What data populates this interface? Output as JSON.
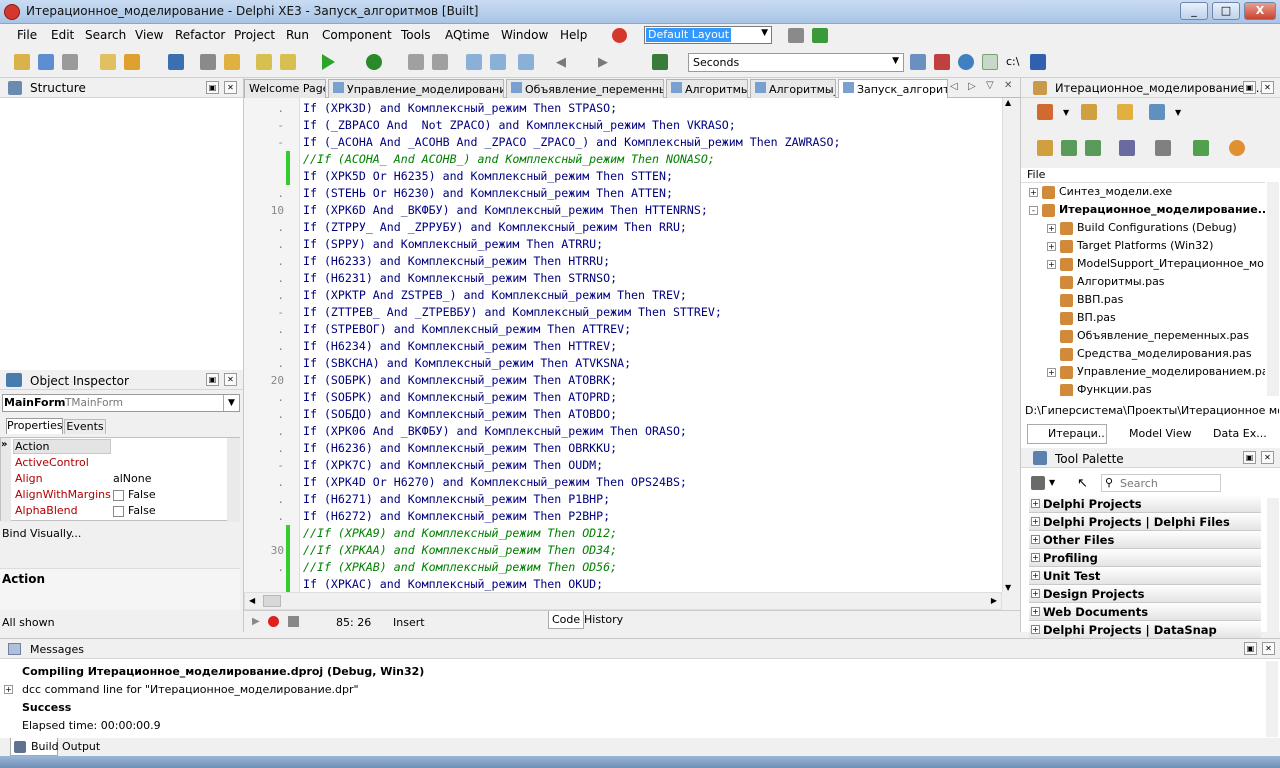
{
  "window": {
    "title": "Итерационное_моделирование - Delphi XE3 - Запуск_алгоритмов [Built]",
    "btn_minimize": "_",
    "btn_maximize": "□",
    "btn_close": "X"
  },
  "menu": [
    "File",
    "Edit",
    "Search",
    "View",
    "Refactor",
    "Project",
    "Run",
    "Component",
    "Tools",
    "AQtime",
    "Window",
    "Help"
  ],
  "layout_select": "Default Layout",
  "toolbar": {
    "seconds": "Seconds",
    "path_icon_label": "c:\\"
  },
  "structure": {
    "title": "Structure"
  },
  "object_inspector": {
    "title": "Object Inspector",
    "selected_name": "MainForm",
    "selected_type": "TMainForm",
    "tab_properties": "Properties",
    "tab_events": "Events",
    "props": [
      {
        "name": "Action",
        "value": ""
      },
      {
        "name": "ActiveControl",
        "value": ""
      },
      {
        "name": "Align",
        "value": "alNone"
      },
      {
        "name": "AlignWithMargins",
        "value": "False"
      },
      {
        "name": "AlphaBlend",
        "value": "False"
      }
    ],
    "bind_visually": "Bind Visually...",
    "desc_title": "Action",
    "footer": "All shown"
  },
  "editor": {
    "tabs": [
      "Welcome Page",
      "Управление_моделированием",
      "Объявление_переменных",
      "Алгоритмы",
      "Алгоритмы_",
      "Запуск_алгоритм"
    ],
    "line_numbers": [
      {
        "row": 6,
        "num": "10"
      },
      {
        "row": 16,
        "num": "20"
      },
      {
        "row": 26,
        "num": "30"
      }
    ],
    "lines": [
      {
        "text": "If (XPK3D) and Комплексный_режим Then STPASO;",
        "cmt": false,
        "mark": false,
        "g": "."
      },
      {
        "text": "If (_ZBPACO And  Not ZPACO) and Комплексный_режим Then VKRASO;",
        "cmt": false,
        "mark": false,
        "g": "-"
      },
      {
        "text": "If (_ACOHA And _ACOHB And _ZPACO _ZPACO_) and Комплексный_режим Then ZAWRASO;",
        "cmt": false,
        "mark": false,
        "g": "-"
      },
      {
        "text": "//If (ACOHA_ And ACOHB_) and Комплексный_режим Then NONASO;",
        "cmt": true,
        "mark": true,
        "g": ""
      },
      {
        "text": "If (XPK5D Or H6235) and Комплексный_режим Then STTEN;",
        "cmt": false,
        "mark": true,
        "g": ""
      },
      {
        "text": "If (STEHЬ Or H6230) and Комплексный_режим Then ATTEN;",
        "cmt": false,
        "mark": false,
        "g": "."
      },
      {
        "text": "If (XPK6D And _BKФБУ) and Комплексный_режим Then HTTENRNS;",
        "cmt": false,
        "mark": false,
        "g": ""
      },
      {
        "text": "If (ZTPPУ_ And _ZPPУБУ) and Комплексный_режим Then RRU;",
        "cmt": false,
        "mark": false,
        "g": "."
      },
      {
        "text": "If (SPPУ) and Комплексный_режим Then ATRRU;",
        "cmt": false,
        "mark": false,
        "g": "."
      },
      {
        "text": "If (H6233) and Комплексный_режим Then HTRRU;",
        "cmt": false,
        "mark": false,
        "g": "."
      },
      {
        "text": "If (H6231) and Комплексный_режим Then STRNSO;",
        "cmt": false,
        "mark": false,
        "g": "."
      },
      {
        "text": "If (XPKTP And ZSTPEB_) and Комплексный_режим Then TREV;",
        "cmt": false,
        "mark": false,
        "g": "."
      },
      {
        "text": "If (ZTTPEB_ And _ZTPEBБУ) and Комплексный_режим Then STTREV;",
        "cmt": false,
        "mark": false,
        "g": "-"
      },
      {
        "text": "If (STPEBOГ) and Комплексный_режим Then ATTREV;",
        "cmt": false,
        "mark": false,
        "g": "."
      },
      {
        "text": "If (H6234) and Комплексный_режим Then HTTREV;",
        "cmt": false,
        "mark": false,
        "g": "."
      },
      {
        "text": "If (SBKCHA) and Комплексный_режим Then ATVKSNA;",
        "cmt": false,
        "mark": false,
        "g": "."
      },
      {
        "text": "If (SOБPK) and Комплексный_режим Then ATOBRK;",
        "cmt": false,
        "mark": false,
        "g": ""
      },
      {
        "text": "If (SOБPK) and Комплексный_режим Then ATOPRD;",
        "cmt": false,
        "mark": false,
        "g": "."
      },
      {
        "text": "If (SOБДO) and Комплексный_режим Then ATOBDO;",
        "cmt": false,
        "mark": false,
        "g": "."
      },
      {
        "text": "If (XPK06 And _BKФБУ) and Комплексный_режим Then ORASO;",
        "cmt": false,
        "mark": false,
        "g": "."
      },
      {
        "text": "If (H6236) and Комплексный_режим Then OBRKKU;",
        "cmt": false,
        "mark": false,
        "g": "."
      },
      {
        "text": "If (XPK7C) and Комплексный_режим Then OUDM;",
        "cmt": false,
        "mark": false,
        "g": "-"
      },
      {
        "text": "If (XPK4D Or H6270) and Комплексный_режим Then OPS24BS;",
        "cmt": false,
        "mark": false,
        "g": "."
      },
      {
        "text": "If (H6271) and Комплексный_режим Then P1BHP;",
        "cmt": false,
        "mark": false,
        "g": "."
      },
      {
        "text": "If (H6272) and Комплексный_режим Then P2BHP;",
        "cmt": false,
        "mark": false,
        "g": "."
      },
      {
        "text": "//If (XPKA9) and Комплексный_режим Then OD12;",
        "cmt": true,
        "mark": true,
        "g": ""
      },
      {
        "text": "//If (XPKAA) and Комплексный_режим Then OD34;",
        "cmt": true,
        "mark": true,
        "g": ""
      },
      {
        "text": "//If (XPKAB) and Комплексный_режим Then OD56;",
        "cmt": true,
        "mark": true,
        "g": "."
      },
      {
        "text": "If (XPKAC) and Комплексный_режим Then OKUD;",
        "cmt": false,
        "mark": true,
        "g": ""
      }
    ],
    "status_position": "85: 26",
    "status_mode": "Insert",
    "tab_code": "Code",
    "tab_history": "History"
  },
  "project": {
    "title": "Итерационное_моделирование.d...",
    "tree_header": "File",
    "items": [
      {
        "label": "Синтез_модели.exe",
        "indent": 0,
        "bold": false,
        "exp": "+"
      },
      {
        "label": "Итерационное_моделирование...",
        "indent": 0,
        "bold": true,
        "exp": "-"
      },
      {
        "label": "Build Configurations (Debug)",
        "indent": 1,
        "bold": false,
        "exp": "+"
      },
      {
        "label": "Target Platforms (Win32)",
        "indent": 1,
        "bold": false,
        "exp": "+"
      },
      {
        "label": "ModelSupport_Итерационное_мо...",
        "indent": 1,
        "bold": false,
        "exp": "+"
      },
      {
        "label": "Алгоритмы.pas",
        "indent": 1,
        "bold": false,
        "exp": ""
      },
      {
        "label": "ВВП.pas",
        "indent": 1,
        "bold": false,
        "exp": ""
      },
      {
        "label": "ВП.pas",
        "indent": 1,
        "bold": false,
        "exp": ""
      },
      {
        "label": "Объявление_переменных.pas",
        "indent": 1,
        "bold": false,
        "exp": ""
      },
      {
        "label": "Средства_моделирования.pas",
        "indent": 1,
        "bold": false,
        "exp": ""
      },
      {
        "label": "Управление_моделированием.pas",
        "indent": 1,
        "bold": false,
        "exp": "+"
      },
      {
        "label": "Функции.pas",
        "indent": 1,
        "bold": false,
        "exp": ""
      }
    ],
    "path": "D:\\Гиперсистема\\Проекты\\Итерационное моделир",
    "tabs": [
      "Итераци...",
      "Model View",
      "Data Ex..."
    ]
  },
  "palette": {
    "title": "Tool Palette",
    "search_placeholder": "Search",
    "categories": [
      "Delphi Projects",
      "Delphi Projects | Delphi Files",
      "Other Files",
      "Profiling",
      "Unit Test",
      "Design Projects",
      "Web Documents",
      "Delphi Projects | DataSnap Server"
    ]
  },
  "messages": {
    "title": "Messages",
    "lines": [
      {
        "text": "Compiling Итерационное_моделирование.dproj (Debug, Win32)",
        "bold": true,
        "exp": ""
      },
      {
        "text": "dcc command line for \"Итерационное_моделирование.dpr\"",
        "bold": false,
        "exp": "+"
      },
      {
        "text": "Success",
        "bold": true,
        "exp": ""
      },
      {
        "text": "Elapsed time: 00:00:00.9",
        "bold": false,
        "exp": ""
      }
    ],
    "tab_build": "Build",
    "tab_output": "Output"
  }
}
